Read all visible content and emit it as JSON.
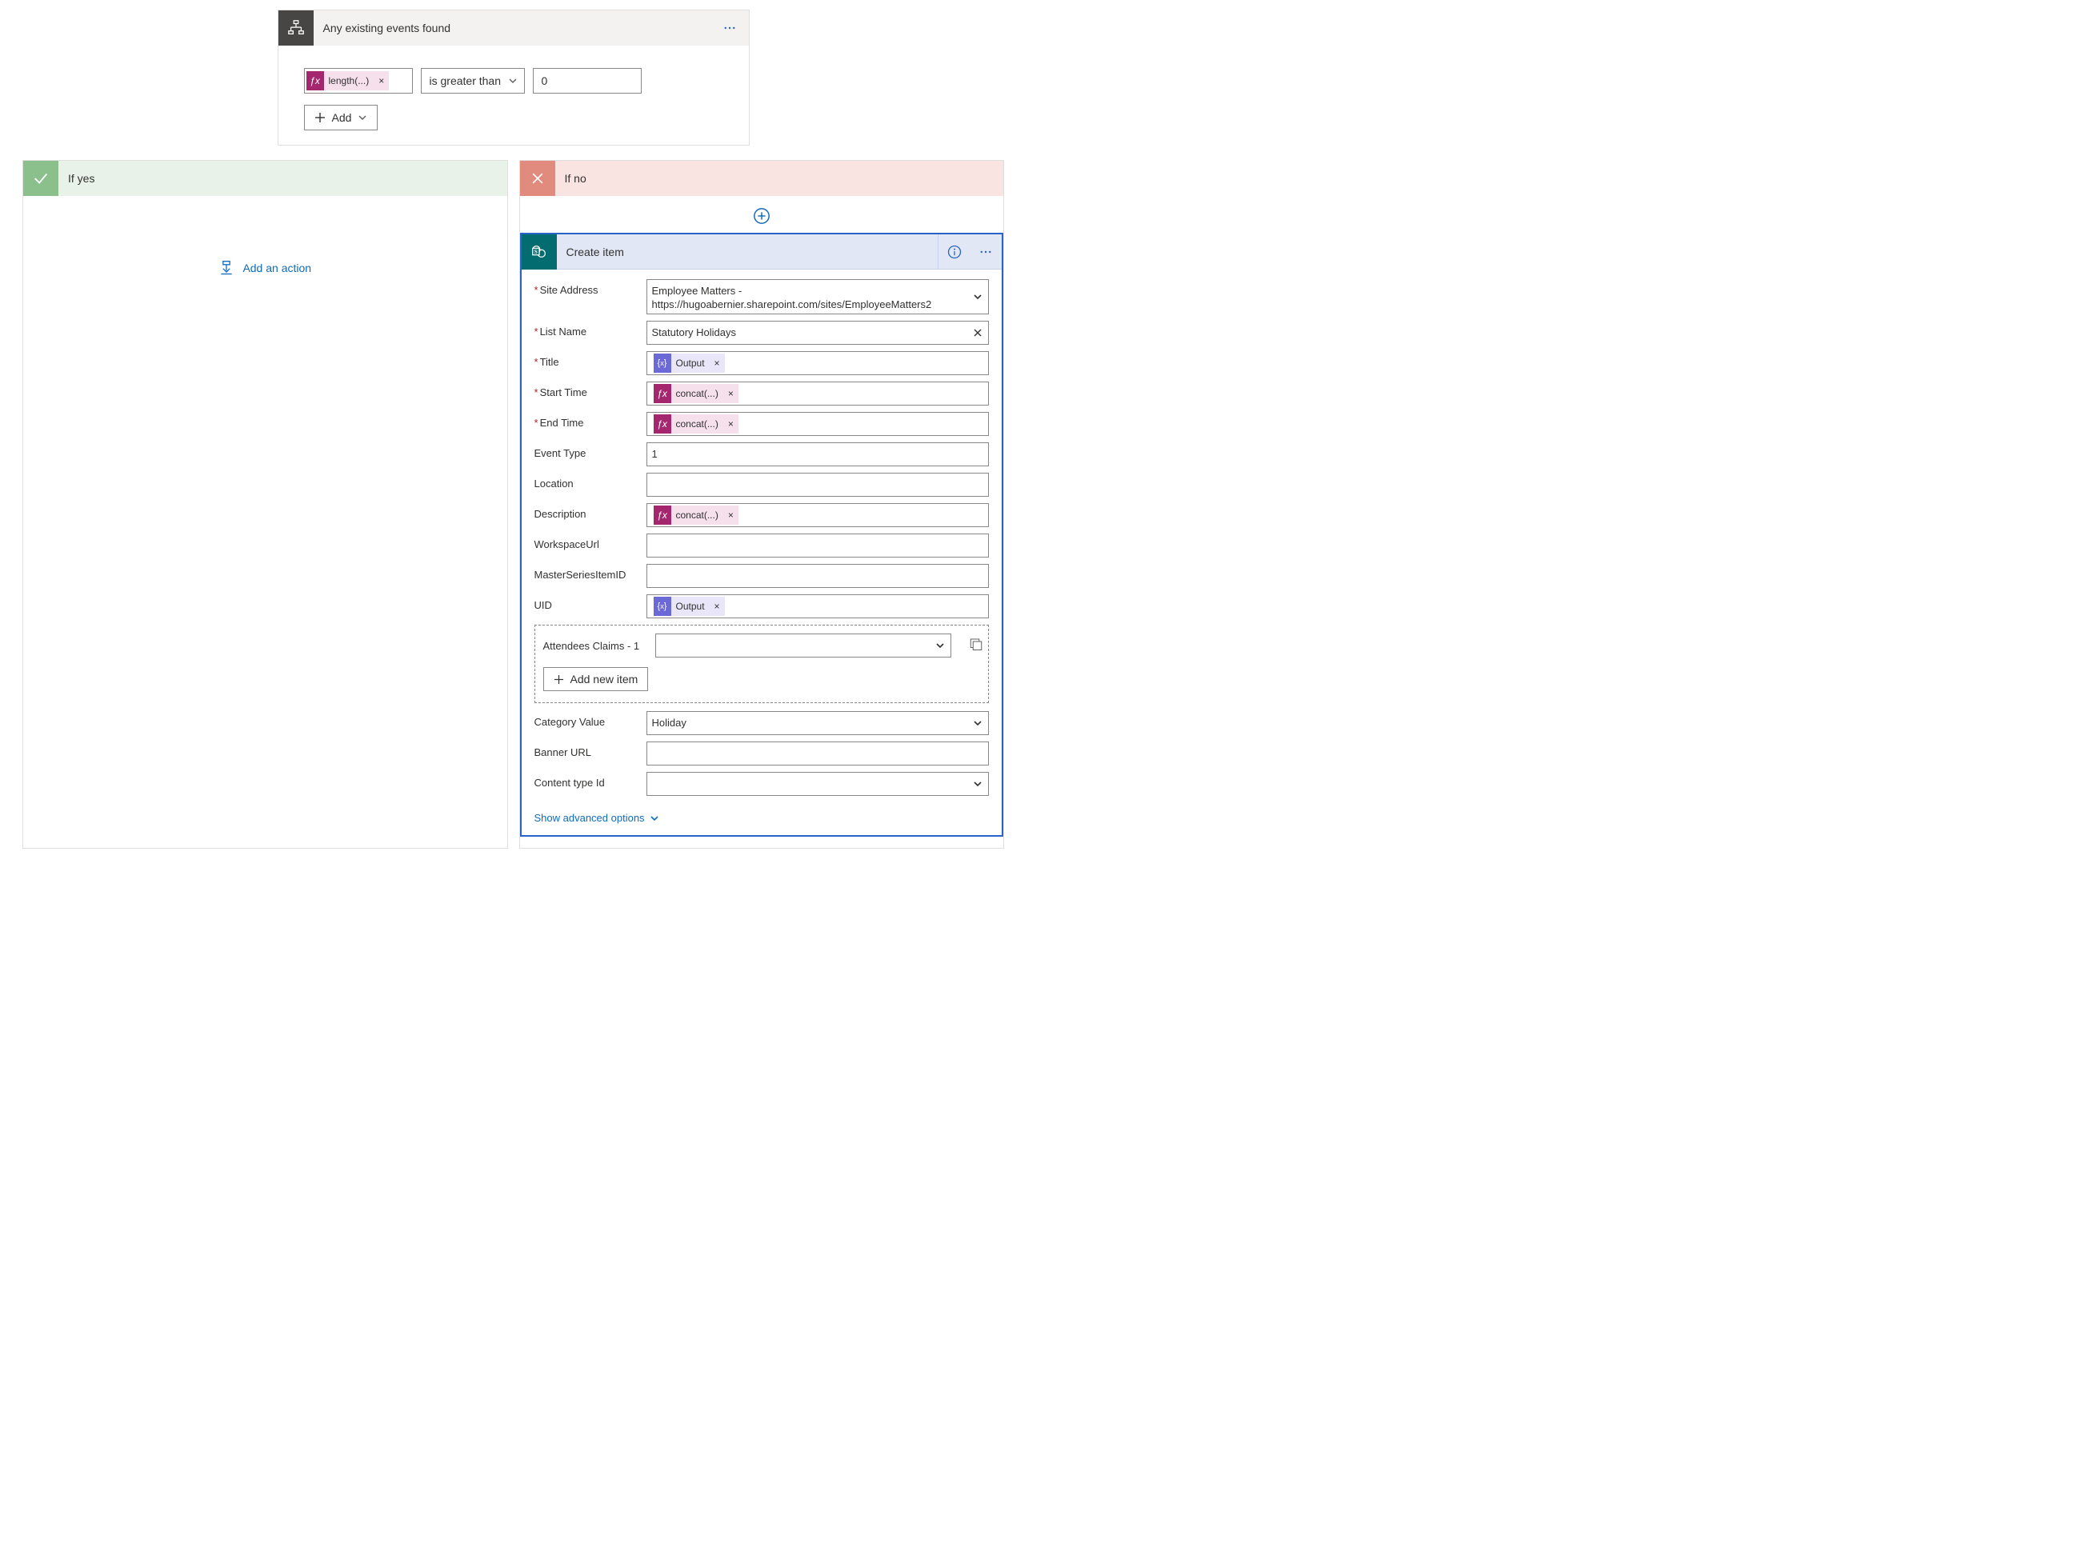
{
  "condition": {
    "title": "Any existing events found",
    "expr_token": "length(...)",
    "operator": "is greater than",
    "value": "0",
    "add_label": "Add"
  },
  "branch_yes": {
    "title": "If yes",
    "add_action_label": "Add an action"
  },
  "branch_no": {
    "title": "If no"
  },
  "create_item": {
    "title": "Create item",
    "labels": {
      "site_address": "Site Address",
      "list_name": "List Name",
      "title_field": "Title",
      "start_time": "Start Time",
      "end_time": "End Time",
      "event_type": "Event Type",
      "location": "Location",
      "description": "Description",
      "workspace_url": "WorkspaceUrl",
      "master_series": "MasterSeriesItemID",
      "uid": "UID",
      "attendees": "Attendees Claims - 1",
      "category": "Category Value",
      "banner_url": "Banner URL",
      "content_type": "Content type Id"
    },
    "values": {
      "site_address": "Employee Matters - https://hugoabernier.sharepoint.com/sites/EmployeeMatters2",
      "list_name": "Statutory Holidays",
      "event_type": "1",
      "category": "Holiday"
    },
    "tokens": {
      "output": "Output",
      "concat": "concat(...)"
    },
    "add_new_item": "Add new item",
    "show_advanced": "Show advanced options"
  }
}
